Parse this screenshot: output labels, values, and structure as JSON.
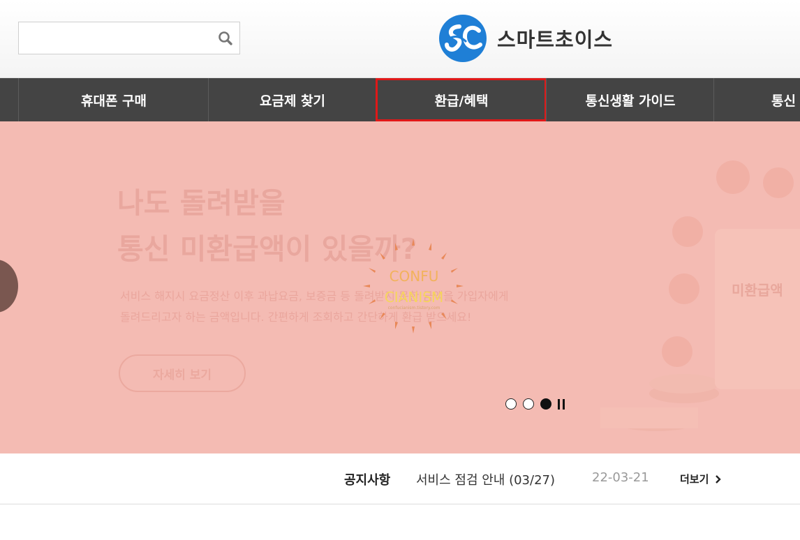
{
  "header": {
    "search": {
      "value": "",
      "placeholder": ""
    },
    "logo": {
      "text": "스마트초이스",
      "icon": "sc-logo-icon"
    }
  },
  "nav": {
    "items": [
      {
        "label": "휴대폰 구매"
      },
      {
        "label": "요금제 찾기"
      },
      {
        "label": "환급/혜택",
        "active": true
      },
      {
        "label": "통신생활 가이드"
      },
      {
        "label": "통신"
      }
    ]
  },
  "banner": {
    "headline_1": "나도 돌려받을",
    "headline_2": "통신 미환급액이 있을까?",
    "sub_1": "서비스 해지시 요금정산 이후 과납요금, 보증금 등 돌려받지 못한 금액을 가입자에게",
    "sub_2": "돌려드리고자 하는 금액입니다. 간편하게 조회하고 간단하게 환급 받으세요!",
    "more_label": "자세히 보기",
    "panel_label": "미환급액",
    "watermark": {
      "line1": "CONFU",
      "line2": "CIANISM",
      "line3": "confucianism.tistory.com"
    },
    "slides": {
      "count": 3,
      "current": 3
    }
  },
  "notice": {
    "label": "공지사항",
    "title": "서비스 점검 안내 (03/27)",
    "date": "22-03-21",
    "more_label": "더보기"
  },
  "colors": {
    "nav_bg": "#444444",
    "active_outline": "#e01818",
    "banner_bg": "#f4bbb3",
    "logo_blue": "#1f7fd6"
  }
}
